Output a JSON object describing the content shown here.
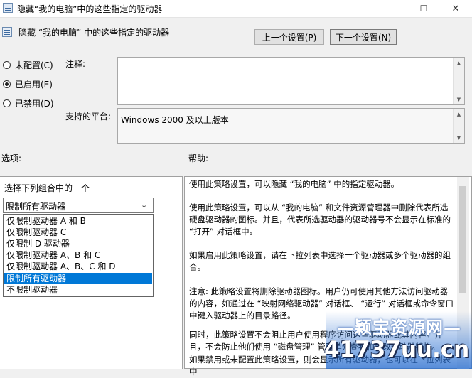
{
  "window": {
    "title": "隐藏“我的电脑”中的这些指定的驱动器",
    "min_glyph": "—",
    "max_glyph": "☐",
    "close_glyph": "✕"
  },
  "header": {
    "policy_name": "隐藏 “我的电脑” 中的这些指定的驱动器",
    "prev_button": "上一个设置(P)",
    "next_button": "下一个设置(N)"
  },
  "state": {
    "options": [
      {
        "label": "未配置(C)",
        "checked": false
      },
      {
        "label": "已启用(E)",
        "checked": true
      },
      {
        "label": "已禁用(D)",
        "checked": false
      }
    ]
  },
  "comment": {
    "label": "注释:",
    "value": ""
  },
  "platform": {
    "label": "支持的平台:",
    "value": "Windows 2000 及以上版本"
  },
  "options_panel": {
    "label": "选项:",
    "instruction": "选择下列组合中的一个",
    "selected": "限制所有驱动器",
    "items": [
      "仅限制驱动器 A 和 B",
      "仅限制驱动器 C",
      "仅限制 D 驱动器",
      "仅限制驱动器 A、B 和 C",
      "仅限制驱动器 A、B、C 和 D",
      "限制所有驱动器",
      "不限制驱动器"
    ],
    "highlighted_index": 5
  },
  "help": {
    "label": "帮助:",
    "paragraphs": [
      "使用此策略设置，可以隐藏 “我的电脑” 中的指定驱动器。",
      "使用此策略设置，可以从 “我的电脑” 和文件资源管理器中删除代表所选硬盘驱动器的图标。并且，代表所选驱动器的驱动器号不会显示在标准的 “打开” 对话框中。",
      "如果启用此策略设置，请在下拉列表中选择一个驱动器或多个驱动器的组合。",
      "注意: 此策略设置将删除驱动器图标。用户仍可使用其他方法访问驱动器的内容，如通过在 “映射网络驱动器” 对话框、 “运行” 对话框或命令窗口中键入驱动器上的目录路径。",
      "同时，此策略设置不会阻止用户使用程序访问这些驱动器或其内容。并且，不会防止他们使用 “磁盘管理” 管理单元查看和更改驱动器特性。",
      "如果禁用或未配置此策略设置，则会显示所有驱动器，也可以在下拉列表中"
    ]
  },
  "watermark": {
    "title": "—颖宝资源网—",
    "site": "41737uu.cn"
  },
  "colors": {
    "selection": "#0078d7",
    "window_bg": "#f0f0f0",
    "watermark_blue": "#2a6fd0"
  }
}
